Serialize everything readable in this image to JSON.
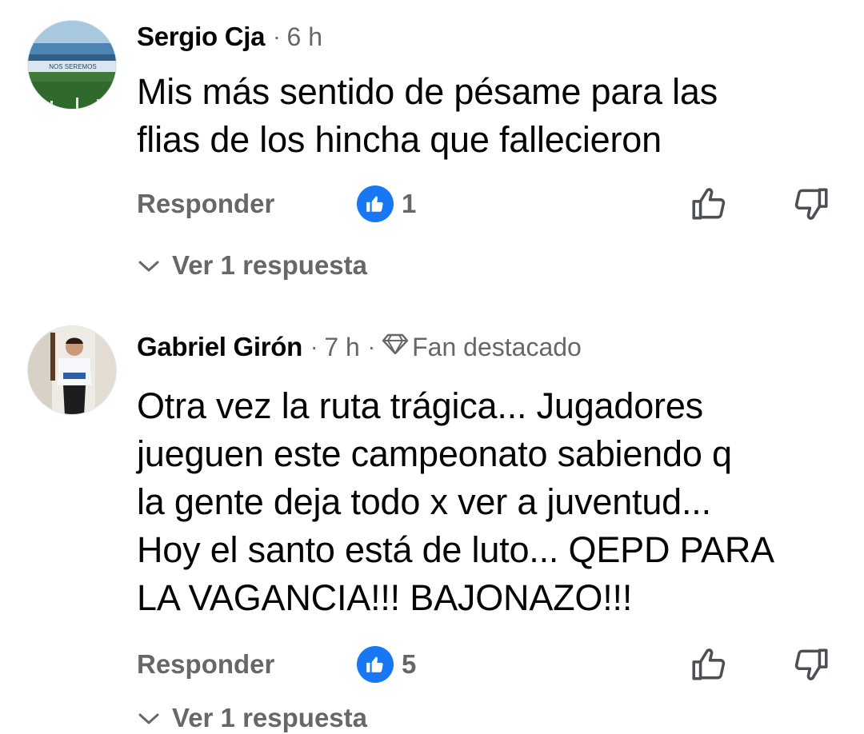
{
  "comments": [
    {
      "author": "Sergio Cja",
      "time": "6 h",
      "badge": "",
      "text": "Mis más sentido de pésame para las\nflias de los hincha que fallecieron",
      "reply_label": "Responder",
      "like_count": "1",
      "view_replies_label": "Ver 1 respuesta",
      "avatar_text": "NOS SEREMOS"
    },
    {
      "author": "Gabriel Girón",
      "time": "7 h",
      "badge": "Fan destacado",
      "text": "Otra vez la ruta trágica... Jugadores\njueguen este campeonato sabiendo q\nla gente deja todo x ver a juventud...\nHoy el santo está de luto... QEPD PARA\nLA VAGANCIA!!! BAJONAZO!!!",
      "reply_label": "Responder",
      "like_count": "5",
      "view_replies_label": "Ver 1 respuesta"
    }
  ],
  "separator": "·",
  "icons": {
    "like_reaction": "thumbs-up-filled-icon",
    "like_action": "thumbs-up-outline-icon",
    "dislike_action": "thumbs-down-outline-icon",
    "expand": "chevron-down-icon",
    "fan_badge": "diamond-icon"
  },
  "colors": {
    "reaction_blue": "#1877f2",
    "secondary_text": "#65676b",
    "primary_text": "#050505"
  }
}
